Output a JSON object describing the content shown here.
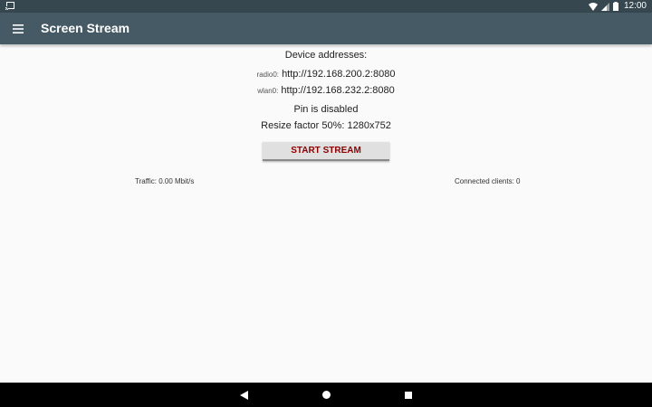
{
  "status_bar": {
    "time": "12:00"
  },
  "toolbar": {
    "title": "Screen Stream",
    "menu_icon": "hamburger-menu-icon"
  },
  "main": {
    "device_addresses_label": "Device addresses:",
    "addresses": [
      {
        "iface": "radio0:",
        "url": "http://192.168.200.2:8080"
      },
      {
        "iface": "wlan0:",
        "url": "http://192.168.232.2:8080"
      }
    ],
    "pin_status": "Pin is disabled",
    "resize_info": "Resize factor 50%: 1280x752",
    "start_button_label": "START STREAM",
    "traffic": "Traffic: 0.00 Mbit/s",
    "connected_clients": "Connected clients: 0"
  },
  "colors": {
    "status_bar": "#37474f",
    "toolbar": "#455a64",
    "button_text": "#8b0000",
    "background": "#fafafa"
  }
}
